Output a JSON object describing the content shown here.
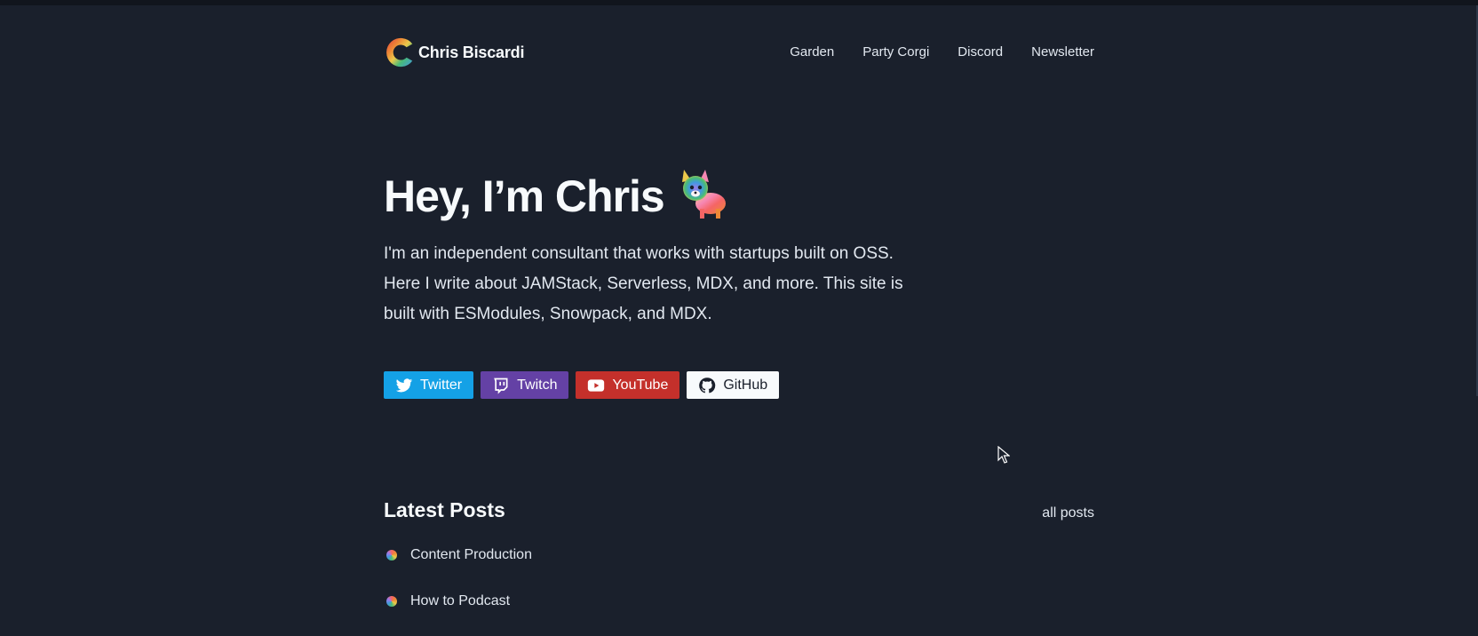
{
  "header": {
    "brand_name": "Chris Biscardi",
    "nav": [
      {
        "label": "Garden"
      },
      {
        "label": "Party Corgi"
      },
      {
        "label": "Discord"
      },
      {
        "label": "Newsletter"
      }
    ]
  },
  "hero": {
    "title": "Hey, I’m Chris",
    "intro": "I'm an independent consultant that works with startups built on OSS. Here I write about JAMStack, Serverless, MDX, and more. This site is built with ESModules, Snowpack, and MDX."
  },
  "socials": [
    {
      "label": "Twitter",
      "icon": "twitter-icon",
      "color": "#14a1e6"
    },
    {
      "label": "Twitch",
      "icon": "twitch-icon",
      "color": "#6441a5"
    },
    {
      "label": "YouTube",
      "icon": "youtube-icon",
      "color": "#c4302b"
    },
    {
      "label": "GitHub",
      "icon": "github-icon",
      "color": "#f7fafc"
    }
  ],
  "posts": {
    "title": "Latest Posts",
    "all_label": "all posts",
    "items": [
      {
        "label": "Content Production"
      },
      {
        "label": "How to Podcast"
      }
    ]
  },
  "colors": {
    "background": "#1a202c",
    "text": "#f7fafc"
  }
}
